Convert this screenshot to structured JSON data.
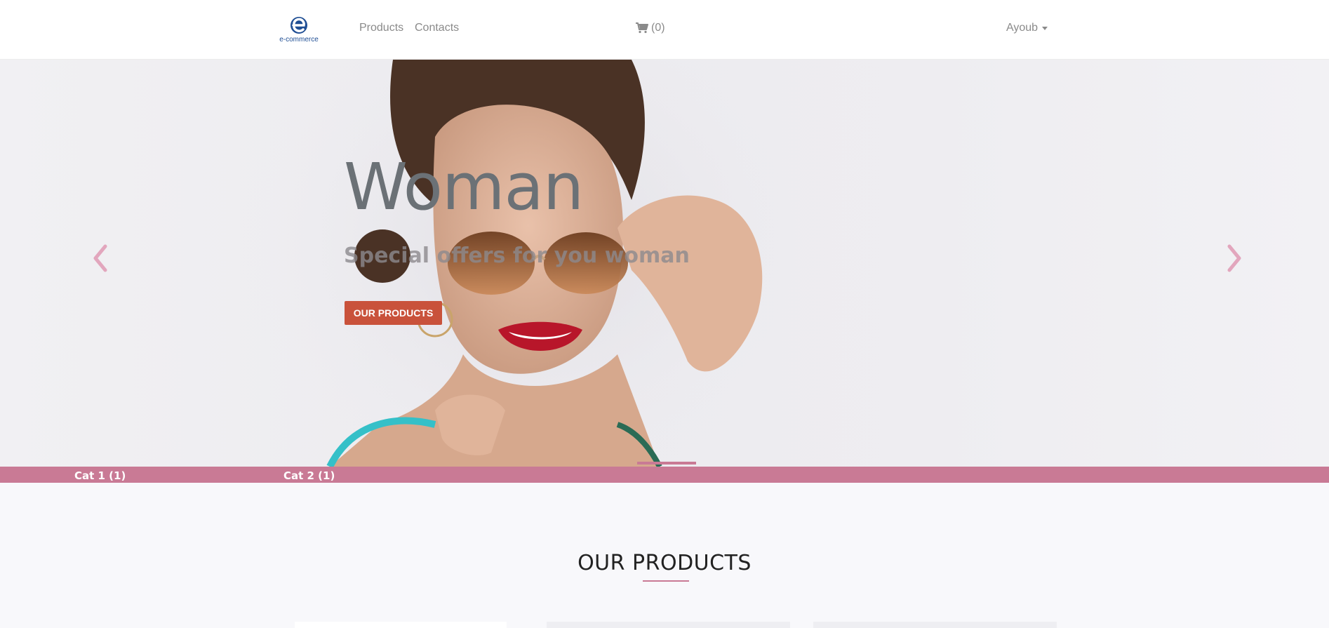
{
  "header": {
    "logo_text": "e-commerce",
    "nav": {
      "products": "Products",
      "contacts": "Contacts"
    },
    "cart": {
      "icon": "shopping-cart-icon",
      "count_label": "(0)"
    },
    "user": {
      "name": "Ayoub",
      "icon": "caret-down-icon"
    }
  },
  "hero": {
    "title": "Woman",
    "subtitle": "Special offers for you woman",
    "button_label": "OUR PRODUCTS",
    "prev_icon": "chevron-left-icon",
    "next_icon": "chevron-right-icon"
  },
  "categories": [
    {
      "label": "Cat 1 (1)"
    },
    {
      "label": "Cat 2 (1)"
    }
  ],
  "section": {
    "title": "OUR PRODUCTS"
  },
  "colors": {
    "accent_pink": "#c97a95",
    "button_orange": "#c9523b",
    "logo_blue": "#1f4e94"
  }
}
